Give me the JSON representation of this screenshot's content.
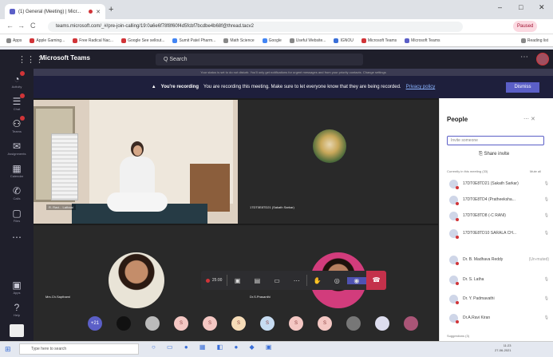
{
  "browser": {
    "tab_title": "(1) General (Meeting) | Micr...",
    "new_tab": "+",
    "window_controls": [
      "–",
      "□",
      "✕"
    ],
    "nav": [
      "←",
      "→",
      "C"
    ],
    "url": "teams.microsoft.com/_#/pre-join-calling/19:0a6e6f78f8f60f4d5fcbf7bcdbe4b68f@thread.tacv2",
    "profile": "Paused",
    "bookmarks": [
      "Apps",
      "Apple Gaming...",
      "Free Radical Nac...",
      "Google See sellout...",
      "Sumit Patel Pharm...",
      "Math Science",
      "Google",
      "Useful Website...",
      "IGNOU",
      "Microsoft Teams",
      "Microsoft Teams",
      "Reading list"
    ]
  },
  "teams": {
    "app_name": "Microsoft Teams",
    "search_placeholder": "Q Search",
    "status_banner": "Your status is set to do not disturb. You'll only get notifications for urgent messages and from your priority contacts. Change settings",
    "recording": {
      "bold": "You're recording",
      "text": "You are recording this meeting. Make sure to let everyone know that they are being recorded.",
      "link": "Privacy policy",
      "dismiss": "Dismiss"
    },
    "rail": [
      {
        "icon": "◔",
        "label": "Activity"
      },
      {
        "icon": "☰",
        "label": "Chat"
      },
      {
        "icon": "⚇",
        "label": "Teams"
      },
      {
        "icon": "✉",
        "label": "Assignments"
      },
      {
        "icon": "▦",
        "label": "Calendar"
      },
      {
        "icon": "✆",
        "label": "Calls"
      },
      {
        "icon": "▢",
        "label": "Files"
      },
      {
        "icon": "⋯",
        "label": ""
      },
      {
        "icon": "▣",
        "label": "Apps"
      },
      {
        "icon": "?",
        "label": "Help"
      }
    ],
    "tiles": [
      {
        "name": "R. Ravi... Lathaai"
      },
      {
        "name": "17DT0E8TD21 (Sakath Sarkar)"
      },
      {
        "name": "Mrs.Ch.Sapthami"
      },
      {
        "name": "Dr.S.Prasanthi"
      }
    ],
    "call": {
      "timer": "25:00",
      "icons": [
        "▣",
        "▤",
        "✋",
        "▭",
        "⋯",
        "✋",
        "◎",
        "◉"
      ],
      "leave": "☎"
    },
    "avatar_row": [
      "+21",
      "",
      "",
      "S",
      "S",
      "S",
      "S",
      "S",
      "S",
      "",
      "",
      ""
    ]
  },
  "people": {
    "title": "People",
    "icons": "⋯ ✕",
    "search_placeholder": "Invite someone",
    "share": "Share invite",
    "section": "Currently in this meeting (33)",
    "mute_all": "Mute all",
    "participants": [
      {
        "name": "17DT0E8TD21 (Sakath Sarkar)"
      },
      {
        "name": "17DT0E8TD4 (Pratheeksha..."
      },
      {
        "name": "17DT0E8TD8 (-C RANI)"
      },
      {
        "name": "17DT0E8TD10 SARALA CH..."
      },
      {
        "name": "Dr. B. Madhava Reddy",
        "tag": "(Un-muted)"
      },
      {
        "name": "Dr. S. Latha"
      },
      {
        "name": "Dr. Y. Padmavathi"
      },
      {
        "name": "Dr.A.Ravi Kiran"
      }
    ],
    "suggestions": "Suggestions (3)"
  },
  "taskbar": {
    "start": "⊞",
    "search": "Type here to search",
    "apps": "○ ▭ ● ▦ ◧ ● ◆ ▣",
    "time": "11:23",
    "date": "27-06-2021"
  }
}
